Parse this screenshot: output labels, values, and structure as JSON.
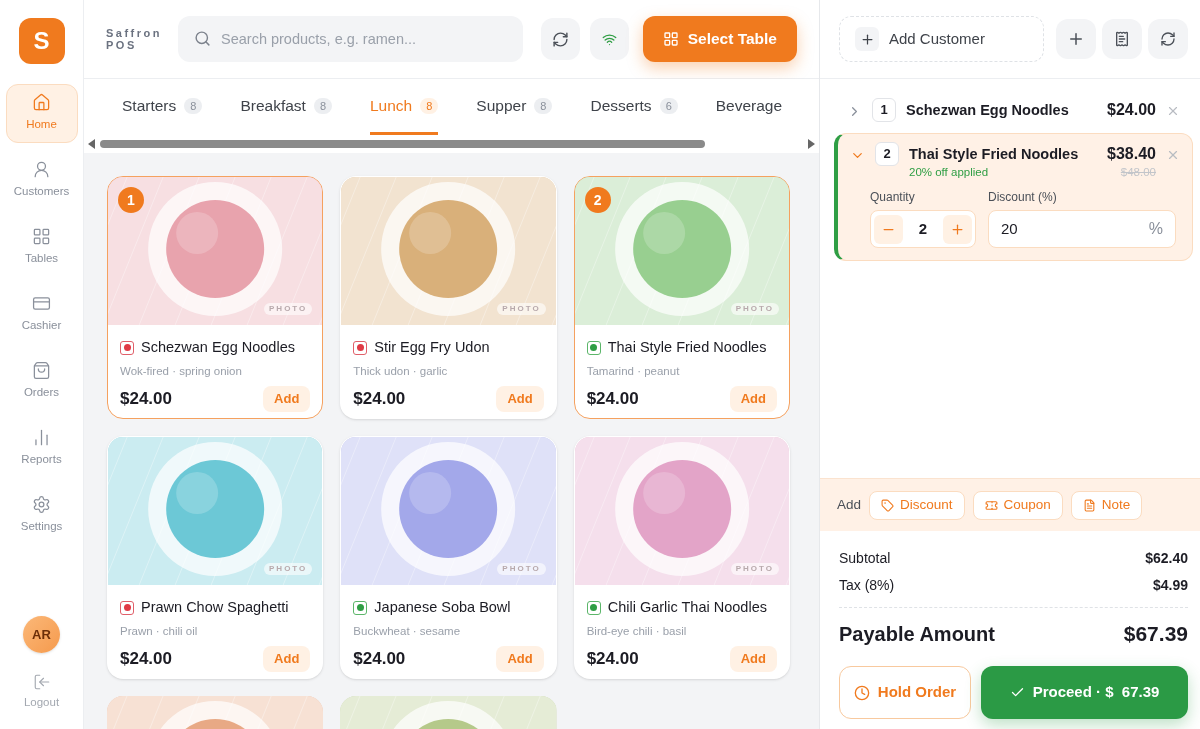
{
  "brand": {
    "logo": "S",
    "name": "Saffron",
    "sub": "POS"
  },
  "nav": [
    {
      "label": "Home",
      "selected": true
    },
    {
      "label": "Customers",
      "selected": false
    },
    {
      "label": "Tables",
      "selected": false
    },
    {
      "label": "Cashier",
      "selected": false
    },
    {
      "label": "Orders",
      "selected": false
    },
    {
      "label": "Reports",
      "selected": false
    },
    {
      "label": "Settings",
      "selected": false
    }
  ],
  "user": {
    "initials": "AR",
    "logout": "Logout"
  },
  "search": {
    "placeholder": "Search products, e.g. ramen..."
  },
  "toolbar": {
    "online": true,
    "select_table": "Select Table"
  },
  "categories": [
    {
      "label": "Starters",
      "count": "8",
      "selected": false
    },
    {
      "label": "Breakfast",
      "count": "8",
      "selected": false
    },
    {
      "label": "Lunch",
      "count": "8",
      "selected": true
    },
    {
      "label": "Supper",
      "count": "8",
      "selected": false
    },
    {
      "label": "Desserts",
      "count": "6",
      "selected": false
    },
    {
      "label": "Beverage",
      "selected": false
    }
  ],
  "products": [
    {
      "name": "Schezwan Egg Noodles",
      "desc": "Wok-fired · spring onion",
      "price": "$24.00",
      "kind": "nonveg",
      "selected": true,
      "badge": "1",
      "tag": "PHOTO",
      "add": "Add",
      "color": "#e8a3ad"
    },
    {
      "name": "Stir Egg Fry Udon",
      "desc": "Thick udon · garlic",
      "price": "$24.00",
      "kind": "nonveg",
      "selected": false,
      "tag": "PHOTO",
      "add": "Add",
      "color": "#d9b07a"
    },
    {
      "name": "Thai Style Fried Noodles",
      "desc": "Tamarind · peanut",
      "price": "$24.00",
      "kind": "veg",
      "selected": true,
      "badge": "2",
      "tag": "PHOTO",
      "add": "Add",
      "color": "#98cf90"
    },
    {
      "name": "Prawn Chow Spaghetti",
      "desc": "Prawn · chili oil",
      "price": "$24.00",
      "kind": "nonveg",
      "selected": false,
      "tag": "PHOTO",
      "add": "Add",
      "color": "#6cc8d6"
    },
    {
      "name": "Japanese Soba Bowl",
      "desc": "Buckwheat · sesame",
      "price": "$24.00",
      "kind": "veg",
      "selected": false,
      "tag": "PHOTO",
      "add": "Add",
      "color": "#a3a8ea"
    },
    {
      "name": "Chili Garlic Thai Noodles",
      "desc": "Bird-eye chili · basil",
      "price": "$24.00",
      "kind": "veg",
      "selected": false,
      "tag": "PHOTO",
      "add": "Add",
      "color": "#e3a4c8"
    },
    {
      "color": "#e8a985"
    },
    {
      "color": "#b5c98a"
    }
  ],
  "cart": {
    "add_customer": "Add Customer",
    "items": [
      {
        "qty": "1",
        "name": "Schezwan Egg Noodles",
        "price": "$24.00",
        "expanded": false
      },
      {
        "qty": "2",
        "name": "Thai Style Fried Noodles",
        "note": "20% off applied",
        "price": "$38.40",
        "old_price": "$48.00",
        "expanded": true,
        "quantity_label": "Quantity",
        "quantity": "2",
        "discount_label": "Discount (%)",
        "discount": "20",
        "unit": "%"
      }
    ],
    "add_label": "Add",
    "add_options": [
      "Discount",
      "Coupon",
      "Note"
    ],
    "summary": [
      {
        "label": "Subtotal",
        "value": "$62.40"
      },
      {
        "label": "Tax (8%)",
        "value": "$4.99"
      }
    ],
    "payable_label": "Payable Amount",
    "payable": "$67.39",
    "hold": "Hold Order",
    "proceed": "Proceed · $  67.39"
  }
}
